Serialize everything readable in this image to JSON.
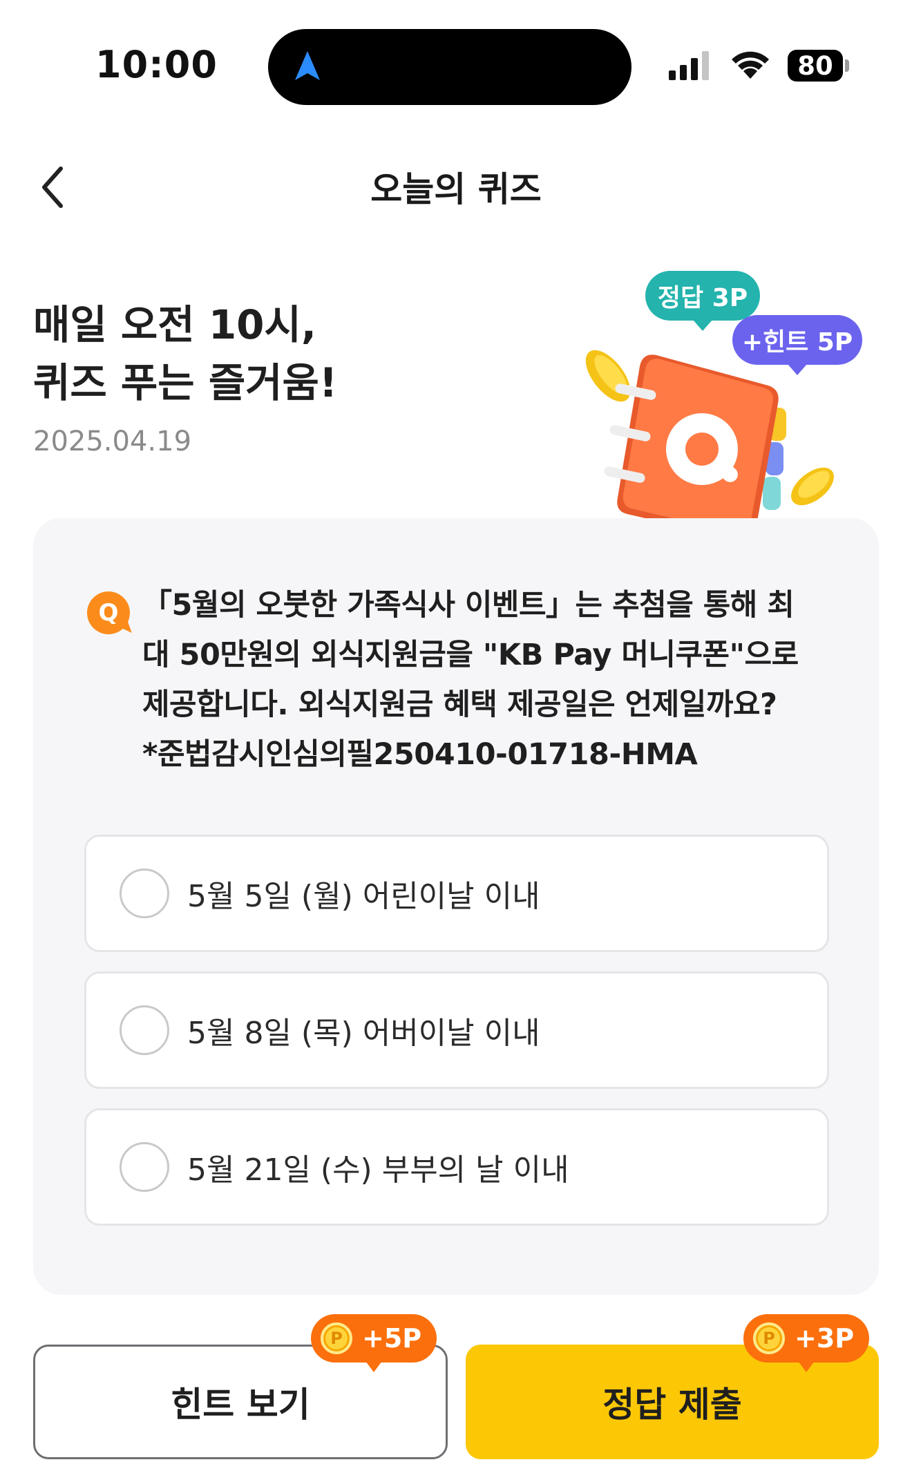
{
  "status_bar": {
    "time": "10:00",
    "battery": "80",
    "icons": [
      "navigation-arrow-icon",
      "cellular-signal-icon",
      "wifi-icon",
      "battery-icon"
    ]
  },
  "header": {
    "title": "오늘의 퀴즈",
    "back_icon": "chevron-left-icon"
  },
  "hero": {
    "heading_line1": "매일 오전 10시,",
    "heading_line2": "퀴즈 푸는 즐거움!",
    "date": "2025.04.19",
    "bubble_answer": "정답 3P",
    "bubble_hint": "+힌트 5P",
    "illustration": "quiz-notebook-icon"
  },
  "quiz": {
    "badge": "Q",
    "question_lines": [
      "「5월의 오붓한 가족식사 이벤트」는 추첨을 통해 최",
      "대 50만원의 외식지원금을 \"KB Pay 머니쿠폰\"으로",
      "제공합니다. 외식지원금 혜택 제공일은 언제일까요?",
      "*준법감시인심의필250410-01718-HMA"
    ],
    "options": [
      {
        "label": "5월 5일 (월) 어린이날 이내"
      },
      {
        "label": "5월 8일 (목) 어버이날 이내"
      },
      {
        "label": "5월 21일 (수) 부부의 날 이내"
      }
    ]
  },
  "actions": {
    "hint_button": "힌트 보기",
    "hint_points": "+5P",
    "submit_button": "정답 제출",
    "submit_points": "+3P",
    "coin_label": "P"
  },
  "colors": {
    "accent_yellow": "#fcc806",
    "accent_orange": "#fb6f0c",
    "teal": "#24b3ad",
    "purple": "#6b63ee"
  }
}
